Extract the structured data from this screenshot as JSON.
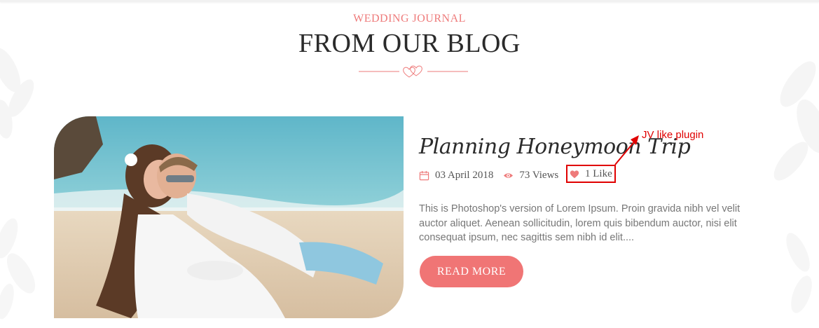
{
  "section": {
    "kicker": "WEDDING JOURNAL",
    "heading": "FROM OUR BLOG"
  },
  "post": {
    "title": "Planning Honeymoon Trip",
    "date": "03 April 2018",
    "views": "73 Views",
    "likes": "1 Like",
    "excerpt": "This is Photoshop's version of Lorem Ipsum. Proin gravida nibh vel velit auctor aliquet. Aenean sollicitudin, lorem quis bibendum auctor, nisi elit consequat ipsum, nec sagittis sem nibh id elit....",
    "read_more_label": "READ MORE"
  },
  "annotation": {
    "text": "JV like plugin"
  },
  "icons": {
    "calendar": "calendar-icon",
    "views": "eye-icon",
    "likes": "heart-icon",
    "divider": "double-heart-icon"
  },
  "colors": {
    "accent": "#f07575",
    "kicker": "#ee7a7a",
    "annotation": "#e00000",
    "heading": "#2b2b2b",
    "body_text": "#777777"
  }
}
